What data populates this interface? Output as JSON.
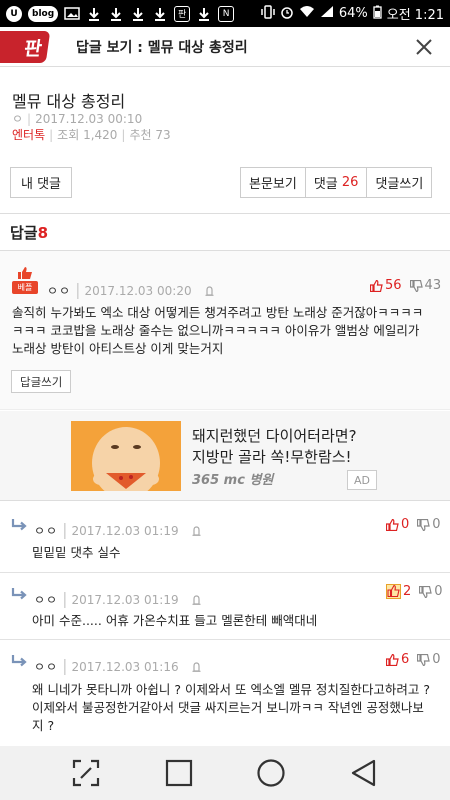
{
  "status_bar": {
    "left_icons": [
      "U",
      "blog",
      "img",
      "dl",
      "dl",
      "dl",
      "dl",
      "판",
      "dl",
      "N"
    ],
    "battery": "64%",
    "time": "오전 1:21"
  },
  "header": {
    "logo": "판",
    "title": "답글 보기 : 멜뮤 대상 총정리"
  },
  "post": {
    "title": "멜뮤 대상 총정리",
    "author": "ㅇ",
    "datetime": "2017.12.03 00:10",
    "category": "엔터톡",
    "views": "조회 1,420",
    "recommends": "추천 73"
  },
  "buttons": {
    "my_comments": "내 댓글",
    "view_post": "본문보기",
    "comments_label": "댓글",
    "comments_count": "26",
    "write_comment": "댓글쓰기"
  },
  "replies_header": {
    "label": "답글",
    "count": "8"
  },
  "best_comment": {
    "badge": "베플",
    "author": "ㅇㅇ",
    "datetime": "2017.12.03 00:20",
    "up": "56",
    "down": "43",
    "lines": [
      "솔직히 누가봐도 엑소 대상 어떻게든 챙겨주려고 방탄 노래상 준거잖아ㅋㅋㅋㅋ",
      "ㅋㅋㅋ 코코밥을 노래상 줄수는 없으니까ㅋㅋㅋㅋㅋ 아이유가 앨범상 에일리가",
      "노래상 방탄이 아티스트상 이게 맞는거지"
    ],
    "reply_button": "답글쓰기"
  },
  "ad": {
    "line1": "돼지런했던 다이어터라면?",
    "line2": "지방만 골라 쏙!무한람스!",
    "brand": "365 mc 병원",
    "tag": "AD"
  },
  "replies": [
    {
      "author": "ㅇㅇ",
      "datetime": "2017.12.03 01:19",
      "up": "0",
      "down": "0",
      "lines": [
        "밑밑밑 댓추 실수"
      ]
    },
    {
      "author": "ㅇㅇ",
      "datetime": "2017.12.03 01:19",
      "up": "2",
      "down": "0",
      "lines": [
        "아미 수준..... 어휴 가온수치표 들고 멜론한테 빼액대네"
      ]
    },
    {
      "author": "ㅇㅇ",
      "datetime": "2017.12.03 01:16",
      "up": "6",
      "down": "0",
      "lines": [
        "왜 니네가 못타니까 아쉽니 ? 이제와서 또 엑소엘 멜뮤 정치질한다고하려고 ?",
        "이제와서 불공정한거같아서 댓글 싸지르는거 보니까ㅋㅋ 작년엔 공정했나보",
        "지 ?"
      ]
    }
  ],
  "colors": {
    "accent": "#d22222",
    "logo": "#c8232c",
    "ad_bg": "#f4a23a"
  }
}
